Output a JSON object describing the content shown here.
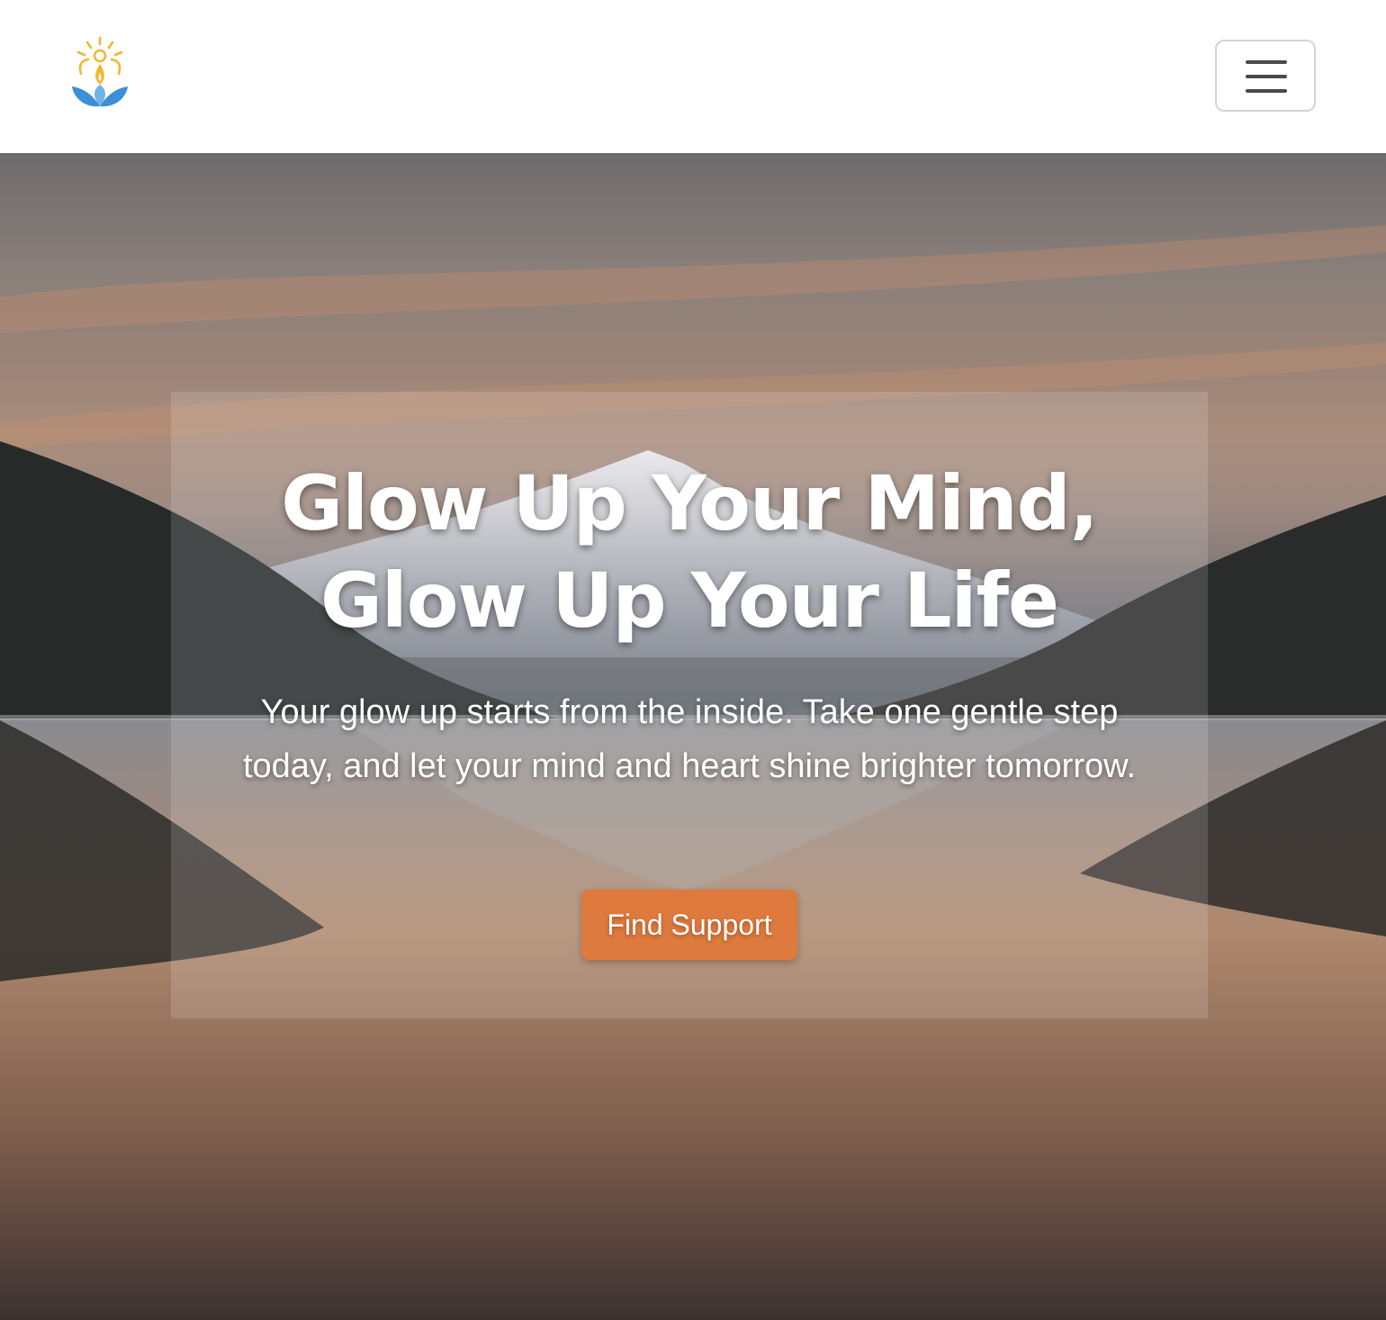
{
  "navbar": {
    "logo_icon": "sun-lotus-logo",
    "menu_icon": "hamburger-menu-icon"
  },
  "hero": {
    "title_line1": "Glow Up Your Mind,",
    "title_line2": "Glow Up Your Life",
    "subtitle": "Your glow up starts from the inside. Take one gentle step today, and let your mind and heart shine brighter tomorrow.",
    "cta_label": "Find Support"
  },
  "colors": {
    "accent": "#de7a3e",
    "logo_sun": "#f2b632",
    "logo_leaf": "#3a8fd6"
  }
}
